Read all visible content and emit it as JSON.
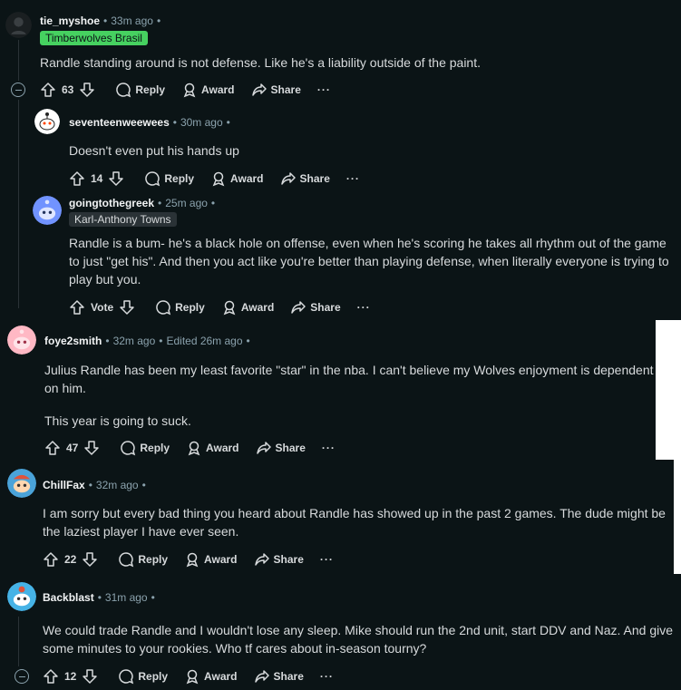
{
  "comments": [
    {
      "user": "tie_myshoe",
      "time": "33m ago",
      "flair": "Timberwolves Brasil",
      "text": [
        "Randle standing around is not defense. Like he's a liability outside of the paint."
      ],
      "votes": "63"
    },
    {
      "user": "seventeenweewees",
      "time": "30m ago",
      "text": [
        "Doesn't even put his hands up"
      ],
      "votes": "14"
    },
    {
      "user": "goingtothegreek",
      "time": "25m ago",
      "flair": "Karl-Anthony Towns",
      "text": [
        "Randle is a bum- he's a black hole on offense, even when he's scoring he takes all rhythm out of the game to just \"get his\". And then you act like you're better than playing defense, when literally everyone is trying to play but you."
      ],
      "votes": "Vote"
    },
    {
      "user": "foye2smith",
      "time": "32m ago",
      "edited": "Edited 26m ago",
      "text": [
        "Julius Randle has been my least favorite \"star\" in the nba. I can't believe my Wolves enjoyment is dependent on him.",
        "This year is going to suck."
      ],
      "votes": "47"
    },
    {
      "user": "ChillFax",
      "time": "32m ago",
      "text": [
        "I am sorry but every bad thing you heard about Randle has showed up in the past 2 games. The dude might be the laziest player I have ever seen."
      ],
      "votes": "22"
    },
    {
      "user": "Backblast",
      "time": "31m ago",
      "text": [
        "We could trade Randle and I wouldn't lose any sleep. Mike should run the 2nd unit, start DDV and Naz. And give some minutes to your rookies. Who tf cares about in-season tourny?"
      ],
      "votes": "12"
    }
  ],
  "labels": {
    "reply": "Reply",
    "award": "Award",
    "share": "Share",
    "more": "···",
    "sep": "•"
  },
  "colors": {
    "bg": "#0b1416",
    "flair1": "#46d160",
    "flair2": "#2a3236"
  }
}
